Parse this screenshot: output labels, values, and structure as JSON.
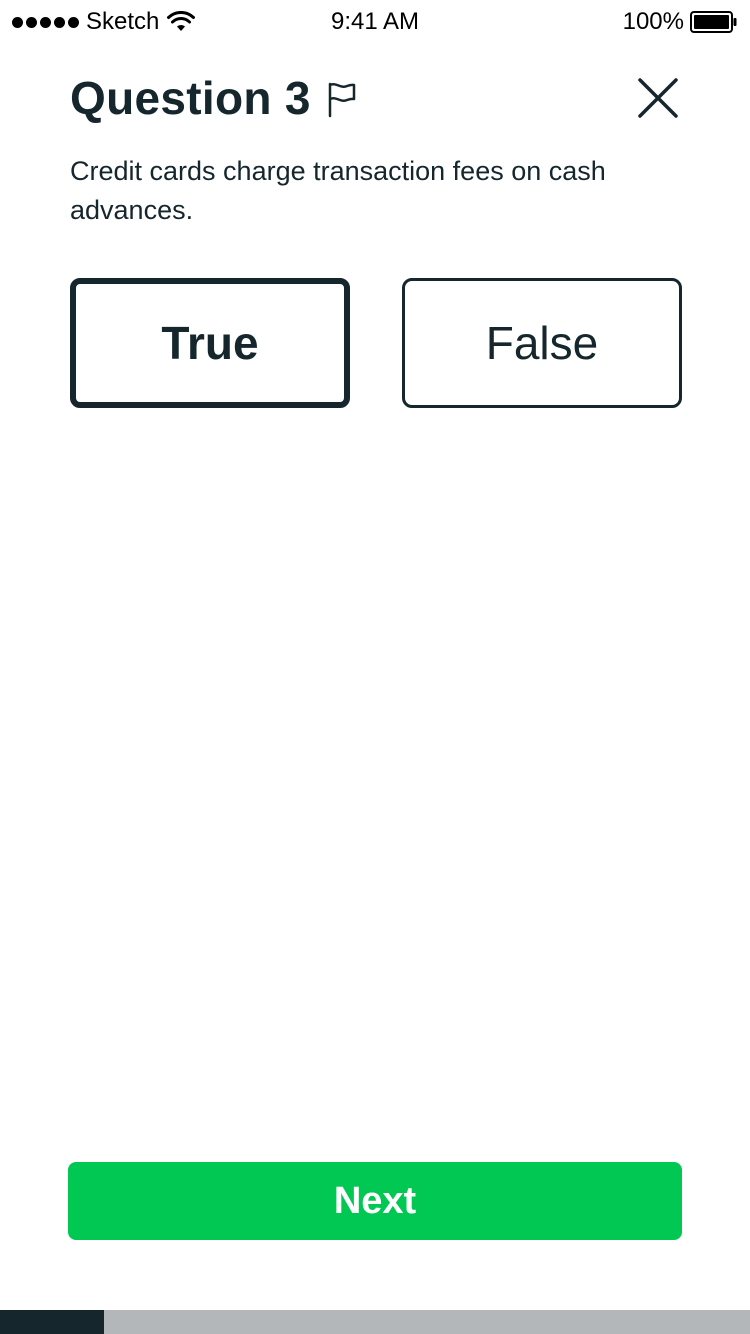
{
  "status_bar": {
    "carrier": "Sketch",
    "time": "9:41 AM",
    "battery": "100%",
    "signal_icon": "signal-dots-icon",
    "wifi_icon": "wifi-icon",
    "battery_icon": "battery-icon"
  },
  "header": {
    "title": "Question 3",
    "flag_icon": "flag-icon",
    "close_icon": "close-icon"
  },
  "question": {
    "prompt": "Credit cards charge transaction fees on cash advances."
  },
  "answers": [
    {
      "label": "True",
      "selected": true
    },
    {
      "label": "False",
      "selected": false
    }
  ],
  "next_button": {
    "label": "Next"
  },
  "progress": {
    "fraction": 0.1387
  },
  "colors": {
    "text_dark": "#15262c",
    "accent_green": "#00c853",
    "progress_track": "#b3b7ba",
    "background": "#ffffff"
  }
}
